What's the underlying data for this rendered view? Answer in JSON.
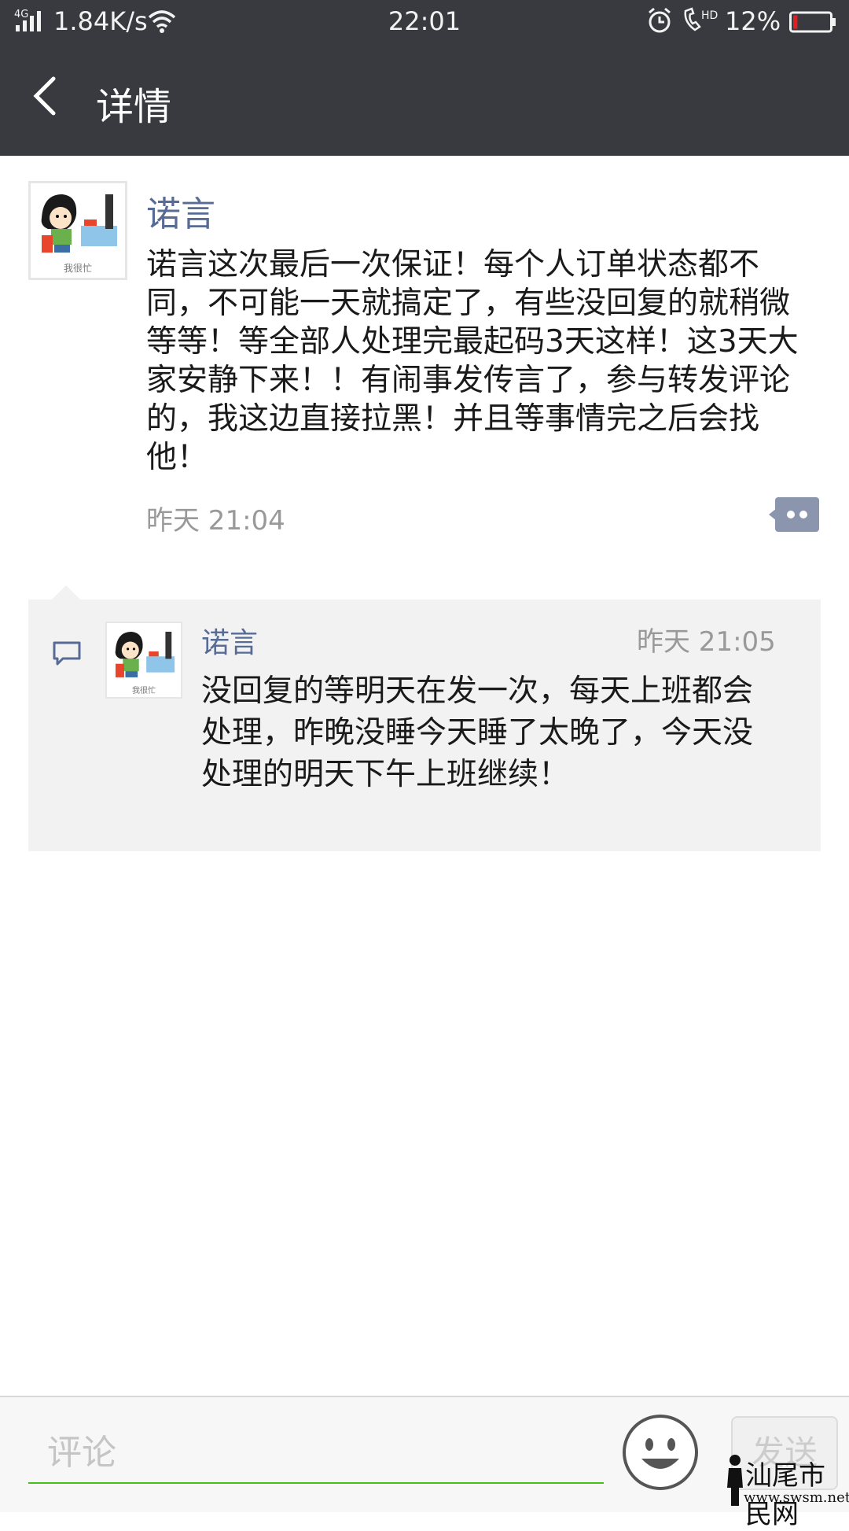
{
  "status_bar": {
    "network": "4G",
    "speed": "1.84K/s",
    "time": "22:01",
    "hd_label": "HD",
    "battery_percent": "12%",
    "battery_level": 0.12
  },
  "header": {
    "title": "详情"
  },
  "post": {
    "avatar_caption": "我很忙",
    "author": "诺言",
    "text": "诺言这次最后一次保证！每个人订单状态都不同，不可能一天就搞定了，有些没回复的就稍微等等！等全部人处理完最起码3天这样！这3天大家安静下来！！有闹事发传言了，参与转发评论的，我这边直接拉黑！并且等事情完之后会找他！",
    "time": "昨天 21:04"
  },
  "comment": {
    "avatar_caption": "我很忙",
    "author": "诺言",
    "time": "昨天 21:05",
    "text": "没回复的等明天在发一次，每天上班都会处理，昨晚没睡今天睡了太晚了，今天没处理的明天下午上班继续！"
  },
  "input_bar": {
    "placeholder": "评论",
    "send_label": "发送"
  },
  "watermark": {
    "text": "汕尾市民网",
    "url": "www.swsm.net"
  },
  "colors": {
    "header_bg": "#393a3f",
    "username": "#576b95",
    "input_underline": "#45c01a",
    "battery_low": "#e02020"
  }
}
